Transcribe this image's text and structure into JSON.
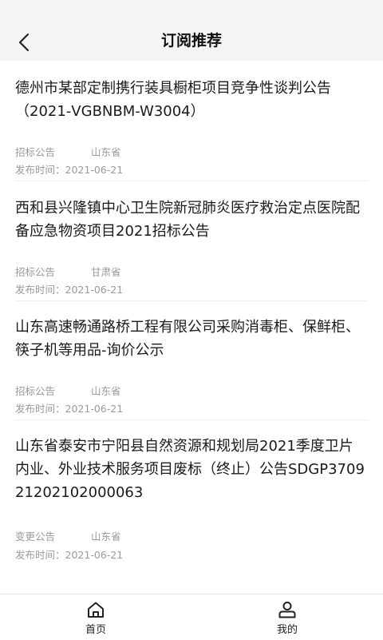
{
  "header": {
    "title": "订阅推荐",
    "back_icon": "chevron-left-icon"
  },
  "items": [
    {
      "title": "德州市某部定制携行装具橱柜项目竞争性谈判公告（2021-VGBNBM-W3004）",
      "category": "招标公告",
      "region": "山东省",
      "date_label": "发布时间：",
      "date": "2021-06-21"
    },
    {
      "title": "西和县兴隆镇中心卫生院新冠肺炎医疗救治定点医院配备应急物资项目2021招标公告",
      "category": "招标公告",
      "region": "甘肃省",
      "date_label": "发布时间：",
      "date": "2021-06-21"
    },
    {
      "title": "山东高速畅通路桥工程有限公司采购消毒柜、保鲜柜、筷子机等用品-询价公示",
      "category": "招标公告",
      "region": "山东省",
      "date_label": "发布时间：",
      "date": "2021-06-21"
    },
    {
      "title": "山东省泰安市宁阳县自然资源和规划局2021季度卫片内业、外业技术服务项目废标（终止）公告SDGP370921202102000063",
      "category": "变更公告",
      "region": "山东省",
      "date_label": "发布时间：",
      "date": "2021-06-21"
    }
  ],
  "tabbar": {
    "home": {
      "label": "首页",
      "icon": "home-icon"
    },
    "mine": {
      "label": "我的",
      "icon": "user-icon"
    }
  }
}
